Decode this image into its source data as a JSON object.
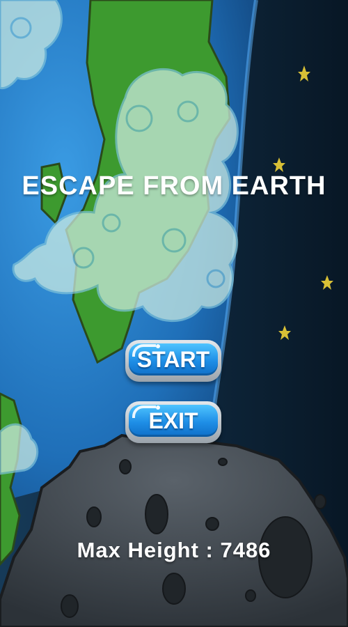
{
  "game": {
    "title": "ESCAPE FROM EARTH"
  },
  "menu": {
    "start_label": "START",
    "exit_label": "EXIT"
  },
  "stats": {
    "max_height_label": "Max Height : 7486"
  },
  "colors": {
    "ocean": "#2b7ccc",
    "land": "#3d9a2f",
    "cloud": "#cfeee4",
    "space": "#0b2033",
    "asteroid": "#3f464d",
    "button_blue": "#1e8ee6",
    "star": "#d8c036"
  }
}
